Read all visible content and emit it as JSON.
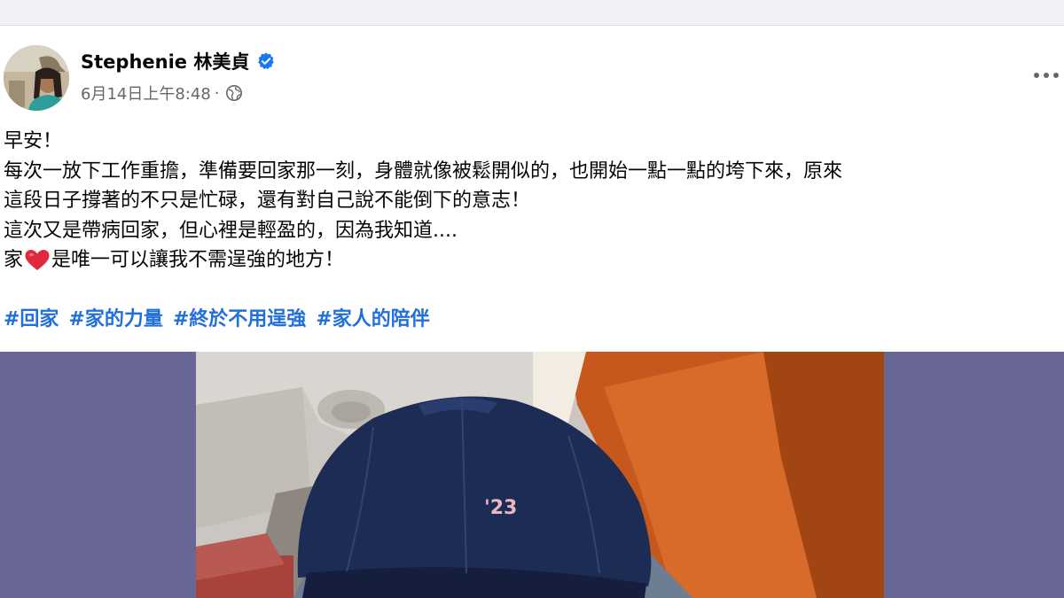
{
  "post": {
    "author_name": "Stephenie 林美貞",
    "timestamp": "6月14日上午8:48",
    "separator": "·",
    "audience_icon": "globe-icon",
    "verified_icon": "verified-badge-icon",
    "more_icon": "more-options-icon",
    "text": {
      "line1": "早安！",
      "line2": "每次一放下工作重擔，準備要回家那一刻，身體就像被鬆開似的，也開始一點一點的垮下來，原來",
      "line3": "這段日子撐著的不只是忙碌，還有對自己說不能倒下的意志！",
      "line4": "這次又是帶病回家，但心裡是輕盈的，因為我知道....",
      "line5_before": "家",
      "line5_after": "是唯一可以讓我不需逞強的地方！"
    },
    "hashtags": [
      "#回家",
      "#家的力量",
      "#終於不用逞強",
      "#家人的陪伴"
    ]
  },
  "photo": {
    "cap_text": "'23"
  },
  "colors": {
    "hashtag": "#216fdb",
    "verified": "#1877f2",
    "media_background": "#686796",
    "heart": "#e0293d"
  }
}
